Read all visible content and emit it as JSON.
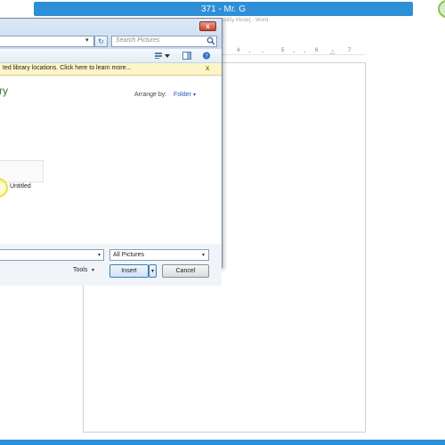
{
  "recording": {
    "title": "371 - Mr. G"
  },
  "word": {
    "caption": "ibility Mode] - Word",
    "ruler": {
      "ticks": [
        "4",
        "5",
        "6",
        "7"
      ]
    }
  },
  "dialog": {
    "search_placeholder": "Search Pictures",
    "close_glyph": "x",
    "refresh_glyph": "↻",
    "address_chevron": "▾",
    "infobar_text": "ted library locations. Click here to learn more...",
    "infobar_close": "x",
    "library_title": "ry",
    "arrange_label": "Arrange by:",
    "arrange_value": "Folder",
    "arrange_chevron": "▾",
    "file_name": "Untitled",
    "filetype_value": "All Pictures",
    "filetype_chevron": "▾",
    "filename_chevron": "▾",
    "tools_label": "Tools",
    "tools_chevron": "▾",
    "insert_label": "Insert",
    "insert_dropdown": "▾",
    "cancel_label": "Cancel"
  },
  "colors": {
    "accent": "#2e8fd6",
    "library_title": "#2e7a3a",
    "link": "#1e5ab5",
    "infobar": "#fcf5c8"
  }
}
